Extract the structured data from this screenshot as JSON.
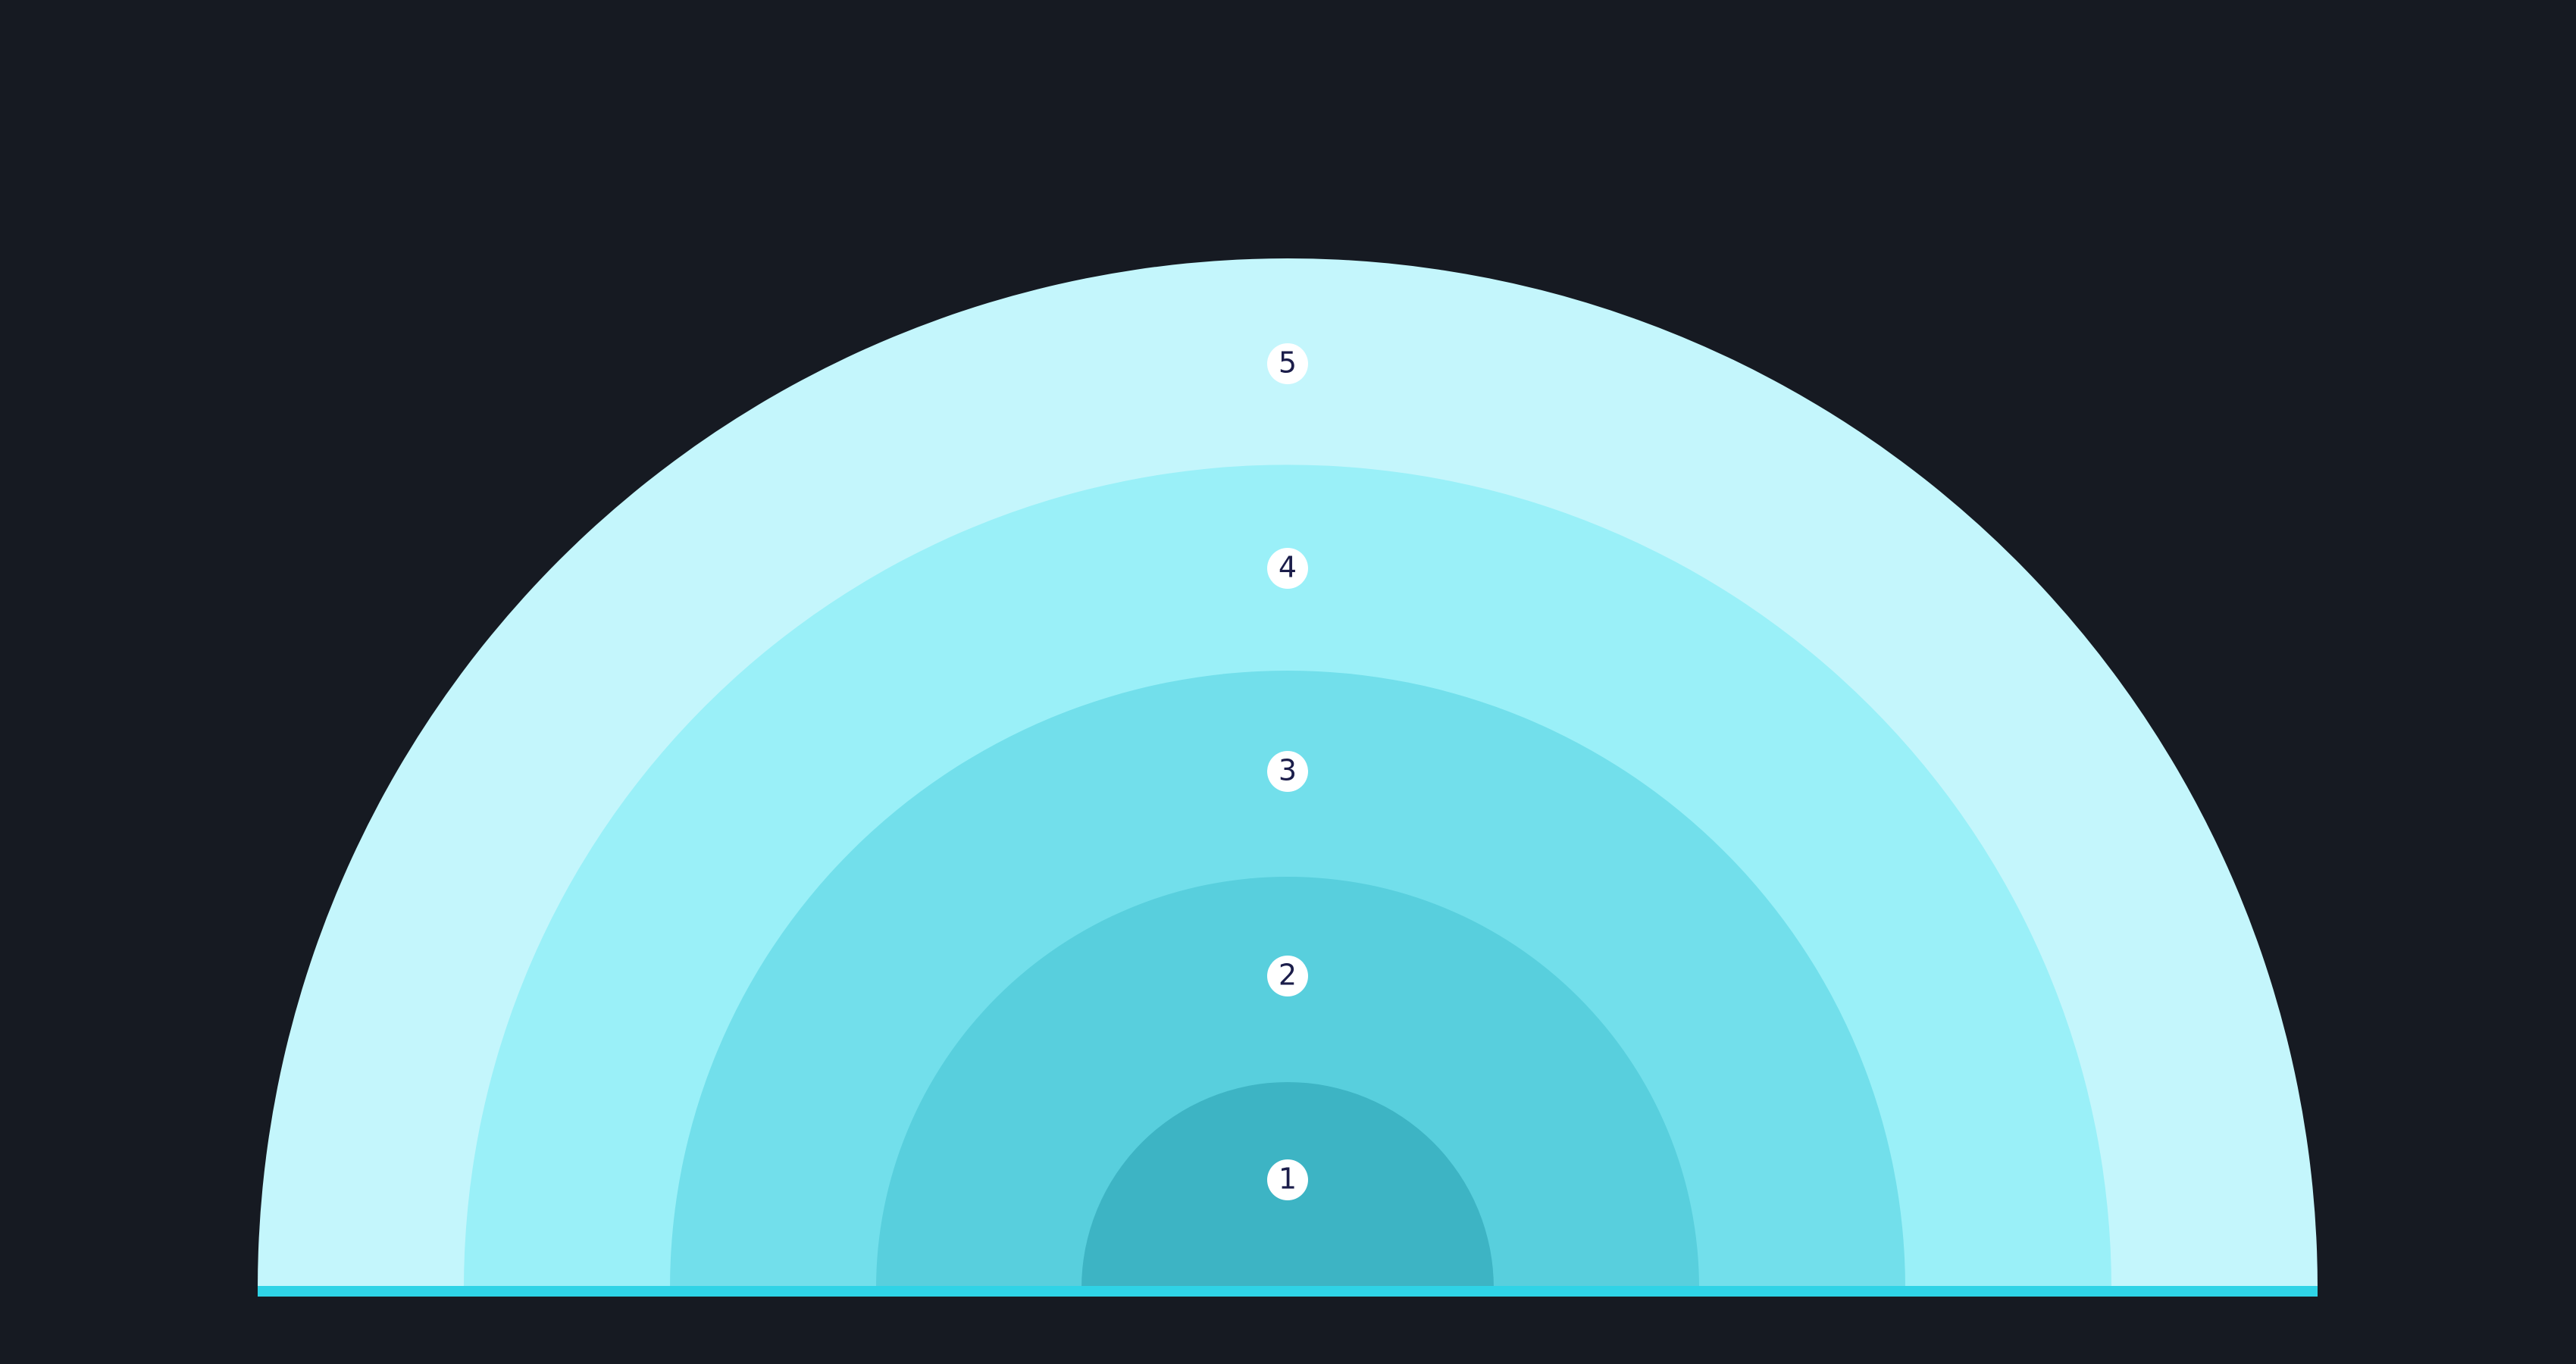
{
  "diagram": {
    "background_color": "#161a22",
    "baseline_color": "#2fd3e6",
    "rings": [
      {
        "label": "1",
        "color": "#3db4c4"
      },
      {
        "label": "2",
        "color": "#58cfdd"
      },
      {
        "label": "3",
        "color": "#72dfeb"
      },
      {
        "label": "4",
        "color": "#9af0f8"
      },
      {
        "label": "5",
        "color": "#c4f6fc"
      }
    ]
  }
}
